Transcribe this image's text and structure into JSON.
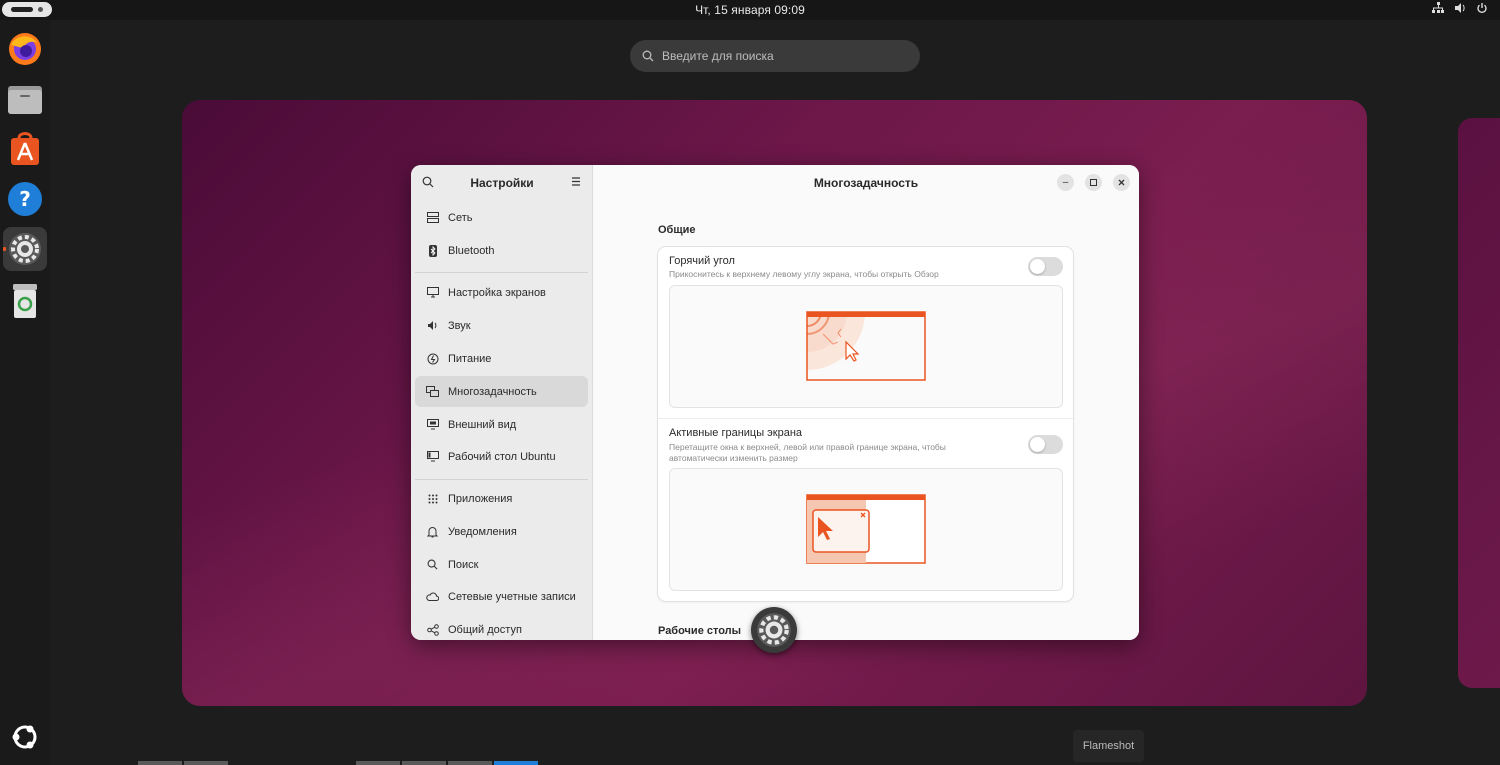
{
  "topbar": {
    "clock": "Чт, 15 января  09:09",
    "tray_icons": [
      "network-icon",
      "volume-icon",
      "power-icon"
    ]
  },
  "dock": {
    "items": [
      {
        "name": "firefox",
        "icon": "firefox-icon"
      },
      {
        "name": "files",
        "icon": "files-icon"
      },
      {
        "name": "app-center",
        "icon": "app-center-icon"
      },
      {
        "name": "help",
        "icon": "help-icon"
      },
      {
        "name": "settings",
        "icon": "settings-gear-icon",
        "active": true
      },
      {
        "name": "trash",
        "icon": "trash-icon"
      }
    ]
  },
  "search": {
    "placeholder": "Введите для поиска"
  },
  "settings": {
    "sidebar_title": "Настройки",
    "items": [
      {
        "label": "Сеть",
        "icon": "network-icon"
      },
      {
        "label": "Bluetooth",
        "icon": "bluetooth-icon"
      },
      {
        "label": "Настройка экранов",
        "icon": "display-icon"
      },
      {
        "label": "Звук",
        "icon": "sound-icon"
      },
      {
        "label": "Питание",
        "icon": "power-icon"
      },
      {
        "label": "Многозадачность",
        "icon": "multitasking-icon",
        "selected": true
      },
      {
        "label": "Внешний вид",
        "icon": "appearance-icon"
      },
      {
        "label": "Рабочий стол Ubuntu",
        "icon": "ubuntu-desktop-icon"
      },
      {
        "label": "Приложения",
        "icon": "apps-grid-icon"
      },
      {
        "label": "Уведомления",
        "icon": "bell-icon"
      },
      {
        "label": "Поиск",
        "icon": "search-icon"
      },
      {
        "label": "Сетевые учетные записи",
        "icon": "cloud-icon"
      },
      {
        "label": "Общий доступ",
        "icon": "share-icon"
      }
    ],
    "page_title": "Многозадачность",
    "section_general": "Общие",
    "hot_corner": {
      "title": "Горячий угол",
      "subtitle": "Прикоснитесь к верхнему левому углу экрана, чтобы открыть Обзор",
      "enabled": false
    },
    "active_edges": {
      "title": "Активные границы экрана",
      "subtitle": "Перетащите окна к верхней, левой или правой границе экрана, чтобы автоматически изменить размер",
      "enabled": false
    },
    "section_workspaces": "Рабочие столы",
    "accent_color": "#e95420"
  },
  "flameshot_label": "Flameshot"
}
